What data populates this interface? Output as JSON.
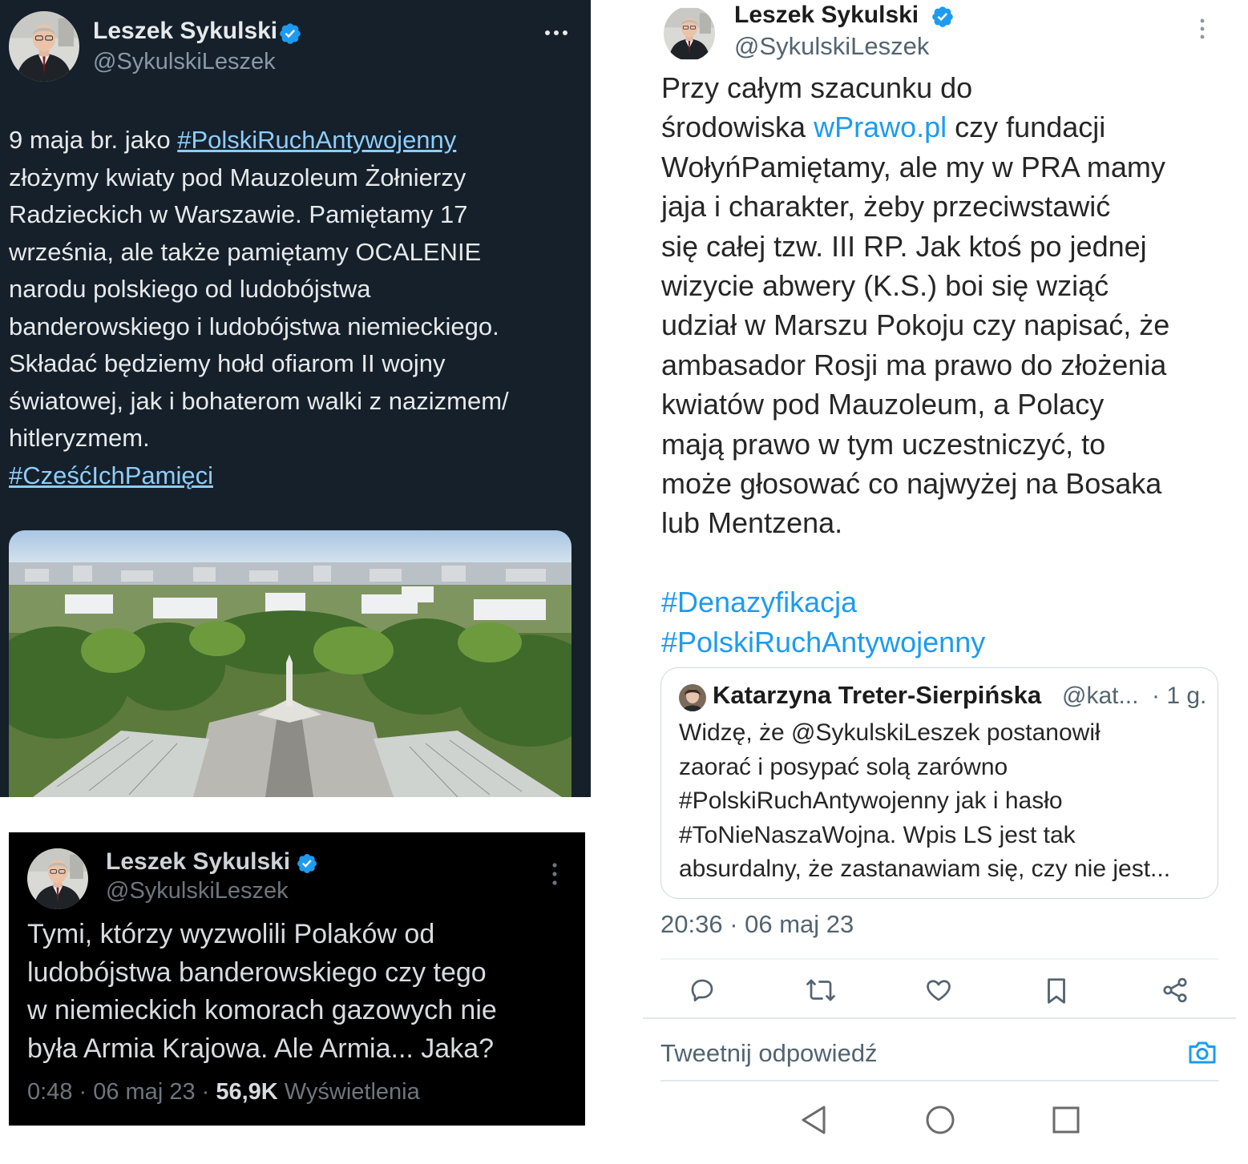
{
  "tweet_dark": {
    "author_name": "Leszek Sykulski",
    "author_handle": "@SykulskiLeszek",
    "body_lines": [
      "9 maja br. jako ",
      "złożymy kwiaty pod Mauzoleum Żołnierzy",
      "Radzieckich w Warszawie. Pamiętamy 17",
      "września, ale także pamiętamy OCALENIE",
      "narodu polskiego od ludobójstwa",
      "banderowskiego i ludobójstwa niemieckiego.",
      "Składać będziemy hołd ofiarom II wojny",
      "światowej, jak i bohaterom walki z nazizmem/",
      "hitleryzmem."
    ],
    "hashtag_1": "#PolskiRuchAntywojenny",
    "hashtag_2": "#CześćIchPamięci"
  },
  "tweet_black": {
    "author_name": "Leszek Sykulski",
    "author_handle": "@SykulskiLeszek",
    "body_lines": [
      "Tymi, którzy wyzwolili Polaków od",
      "ludobójstwa banderowskiego czy tego",
      "w niemieckich komorach gazowych nie",
      "była Armia Krajowa. Ale Armia... Jaka?"
    ],
    "time": "0:48 · 06 maj 23 · ",
    "views_count": "56,9K",
    "views_label": " Wyświetlenia"
  },
  "tweet_light": {
    "author_name": "Leszek Sykulski",
    "author_handle": "@SykulskiLeszek",
    "line_1": "Przy całym szacunku do",
    "line_2_pre": "środowiska ",
    "line_2_link": "wPrawo.pl",
    "line_2_post": " czy fundacji",
    "body_lines": [
      "WołyńPamiętamy, ale my w PRA mamy",
      "jaja i charakter, żeby przeciwstawić",
      "się całej tzw. III RP. Jak ktoś po jednej",
      "wizycie abwery (K.S.) boi się wziąć",
      "udział w Marszu Pokoju czy napisać, że",
      "ambasador Rosji ma prawo do złożenia",
      "kwiatów pod Mauzoleum, a Polacy",
      "mają prawo w tym uczestniczyć, to",
      "może głosować co najwyżej na Bosaka",
      "lub Mentzena."
    ],
    "hashtags": [
      "#Denazyfikacja",
      "#PolskiRuchAntywojenny"
    ],
    "quote": {
      "name": "Katarzyna Treter-Sierpińska",
      "handle": "@kat...",
      "time": "· 1 g.",
      "lines": [
        "Widzę, że @SykulskiLeszek postanowił",
        "zaorać i posypać solą zarówno",
        "#PolskiRuchAntywojenny jak i hasło",
        "#ToNieNaszaWojna. Wpis LS jest tak",
        "absurdalny, że zastanawiam się, czy nie jest..."
      ]
    },
    "timestamp": "20:36 · 06 maj 23",
    "reply_placeholder": "Tweetnij odpowiedź",
    "icons": [
      "reply-icon",
      "retweet-icon",
      "like-icon",
      "bookmark-icon",
      "share-icon",
      "camera-icon"
    ],
    "nav_icons": [
      "back-icon",
      "home-icon",
      "recents-icon"
    ]
  },
  "colors": {
    "dark_bg": "#15202b",
    "black_bg": "#000000",
    "link_dark": "#8ecdf8",
    "link_light": "#1d9bf0",
    "verified": "#1d9bf0"
  }
}
